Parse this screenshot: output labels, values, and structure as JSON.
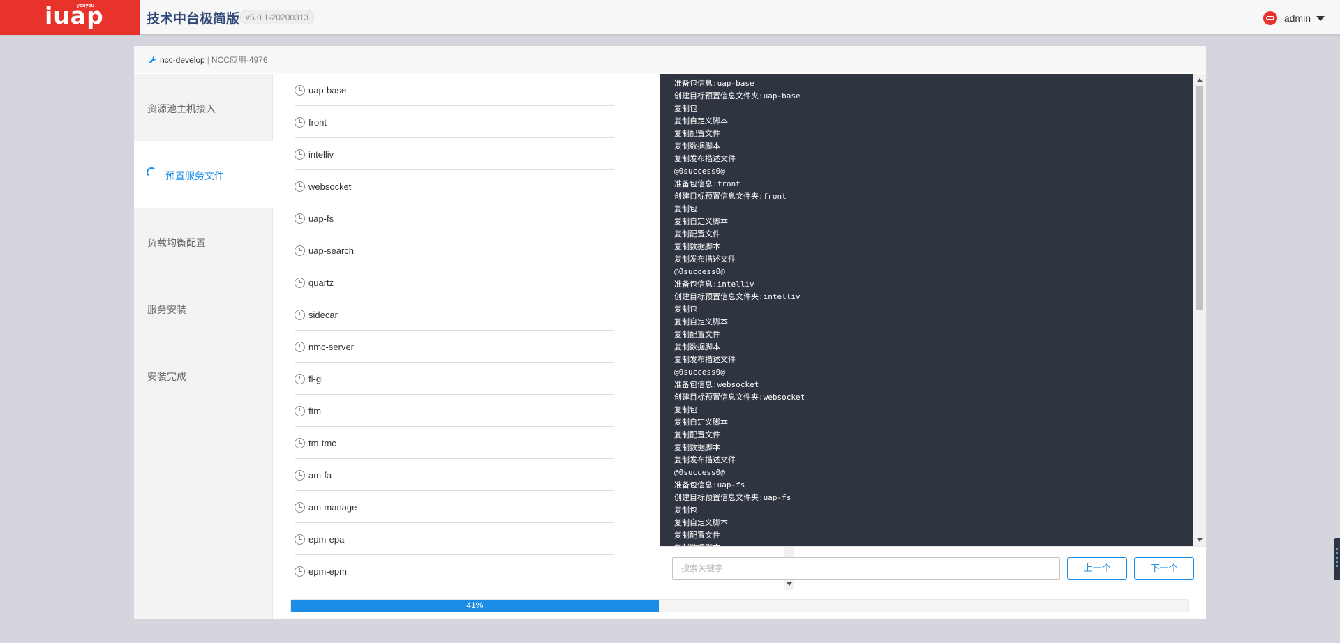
{
  "header": {
    "logo_text": "iuap",
    "logo_sub": "yonyou",
    "title": "技术中台极简版",
    "version": "v5.0.1-20200313",
    "user_name": "admin"
  },
  "breadcrumb": {
    "project": "ncc-develop",
    "separator": "|",
    "app": "NCC应用-4976"
  },
  "steps": [
    {
      "label": "资源池主机接入",
      "state": "done"
    },
    {
      "label": "预置服务文件",
      "state": "active"
    },
    {
      "label": "负载均衡配置",
      "state": "pending"
    },
    {
      "label": "服务安装",
      "state": "pending"
    },
    {
      "label": "安装完成",
      "state": "pending"
    }
  ],
  "packages": [
    "uap-base",
    "front",
    "intelliv",
    "websocket",
    "uap-fs",
    "uap-search",
    "quartz",
    "sidecar",
    "nmc-server",
    "fi-gl",
    "ftm",
    "tm-tmc",
    "am-fa",
    "am-manage",
    "epm-epa",
    "epm-epm"
  ],
  "log_lines": [
    "准备包信息:uap-base",
    "创建目标预置信息文件夹:uap-base",
    "复制包",
    "复制自定义脚本",
    "复制配置文件",
    "复制数据脚本",
    "复制发布描述文件",
    "@0success0@",
    "准备包信息:front",
    "创建目标预置信息文件夹:front",
    "复制包",
    "复制自定义脚本",
    "复制配置文件",
    "复制数据脚本",
    "复制发布描述文件",
    "@0success0@",
    "准备包信息:intelliv",
    "创建目标预置信息文件夹:intelliv",
    "复制包",
    "复制自定义脚本",
    "复制配置文件",
    "复制数据脚本",
    "复制发布描述文件",
    "@0success0@",
    "准备包信息:websocket",
    "创建目标预置信息文件夹:websocket",
    "复制包",
    "复制自定义脚本",
    "复制配置文件",
    "复制数据脚本",
    "复制发布描述文件",
    "@0success0@",
    "准备包信息:uap-fs",
    "创建目标预置信息文件夹:uap-fs",
    "复制包",
    "复制自定义脚本",
    "复制配置文件",
    "复制数据脚本"
  ],
  "search": {
    "placeholder": "搜索关键字",
    "value": "",
    "prev_label": "上一个",
    "next_label": "下一个"
  },
  "progress": {
    "percent": 41,
    "label": "41%"
  },
  "colors": {
    "brand_red": "#e8322c",
    "accent_blue": "#1b8de7",
    "console_bg": "#2f3540"
  }
}
